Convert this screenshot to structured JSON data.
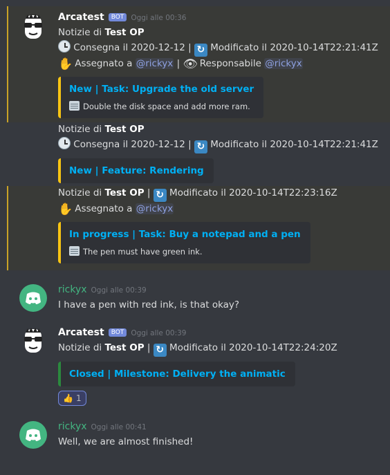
{
  "messages": {
    "m1": {
      "author": "Arcatest",
      "badge": "BOT",
      "timestamp": "Oggi alle 00:36",
      "g1": {
        "prefix": "Notizie di",
        "project": "Test OP",
        "due_text": "Consegna il 2020-12-12 |",
        "modified_text": "Modificato il 2020-10-14T22:21:41Z",
        "assigned_text": "Assegnato a",
        "assignee": "@rickyx",
        "sep": "|",
        "responsible_text": "Responsabile",
        "responsible": "@rickyx",
        "embed_title": "New | Task: Upgrade the old server",
        "embed_desc": "Double the disk space and add more ram."
      },
      "g2": {
        "prefix": "Notizie di",
        "project": "Test OP",
        "due_text": "Consegna il 2020-12-12 |",
        "modified_text": "Modificato il 2020-10-14T22:21:41Z",
        "embed_title": "New | Feature: Rendering"
      },
      "g3": {
        "prefix": "Notizie di",
        "project": "Test OP",
        "sep": "|",
        "modified_text": "Modificato il 2020-10-14T22:23:16Z",
        "assigned_text": "Assegnato a",
        "assignee": "@rickyx",
        "embed_title": "In progress | Task: Buy a notepad and a pen",
        "embed_desc": "The pen must have green ink."
      }
    },
    "m2": {
      "author": "rickyx",
      "timestamp": "Oggi alle 00:39",
      "text": "I have a pen with red ink, is that okay?"
    },
    "m3": {
      "author": "Arcatest",
      "badge": "BOT",
      "timestamp": "Oggi alle 00:39",
      "prefix": "Notizie di",
      "project": "Test OP",
      "sep": "|",
      "modified_text": "Modificato il 2020-10-14T22:24:20Z",
      "embed_title": "Closed | Milestone: Delivery the animatic",
      "reaction_emoji": "👍",
      "reaction_count": "1"
    },
    "m4": {
      "author": "rickyx",
      "timestamp": "Oggi alle 00:41",
      "text": "Well, we are almost finished!"
    }
  },
  "colors": {
    "background": "#36393f",
    "highlight_border": "#c9a227",
    "embed_yellow": "#f9c513",
    "embed_green": "#2b8a3e",
    "link_blue": "#00b0f4",
    "mention": "#8ea1e1",
    "user_green": "#43b581",
    "bot_badge": "#7289da"
  },
  "icons": {
    "clock": "clock-icon",
    "sync": "sync-icon",
    "hand": "raised-hand-icon",
    "eye": "eye-icon",
    "note": "notepad-icon",
    "avatar_bot": "sunglasses-face-icon",
    "avatar_user": "discord-logo-icon"
  }
}
